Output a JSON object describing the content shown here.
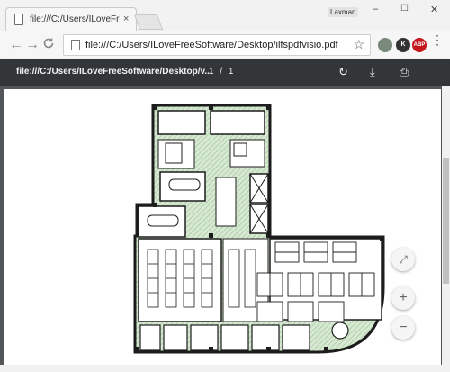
{
  "browser": {
    "tab_title": "file:///C:/Users/ILoveFree",
    "tab_close": "×",
    "username": "Laxman",
    "window": {
      "minimize": "–",
      "maximize": "☐",
      "close": "✕"
    },
    "nav": {
      "back": "←",
      "forward": "→",
      "reload": "C"
    },
    "address": "file:///C:/Users/ILoveFreeSoftware/Desktop/ilfspdfvisio.pdf",
    "star": "☆",
    "extensions": [
      {
        "name": "sheet-extension-icon",
        "label": "",
        "color": "#7a8a7a"
      },
      {
        "name": "k-extension-icon",
        "label": "K",
        "color": "#333333"
      },
      {
        "name": "adblock-icon",
        "label": "ABP",
        "color": "#c4161c"
      }
    ],
    "menu": "⋮"
  },
  "pdf_toolbar": {
    "title": "file:///C:/Users/ILoveFreeSoftware/Desktop/v...",
    "page_current": "1",
    "page_sep": "/",
    "page_total": "1",
    "rotate_icon": "↻",
    "download_icon": "⤓",
    "print_icon": "⎙"
  },
  "floating": {
    "fit": "⤢",
    "zoom_in": "+",
    "zoom_out": "−"
  },
  "colors": {
    "pdfbar": "#323639",
    "viewer_bg": "#525659",
    "wall": "#1c1c1c",
    "hatch": "#b7d3b2"
  }
}
